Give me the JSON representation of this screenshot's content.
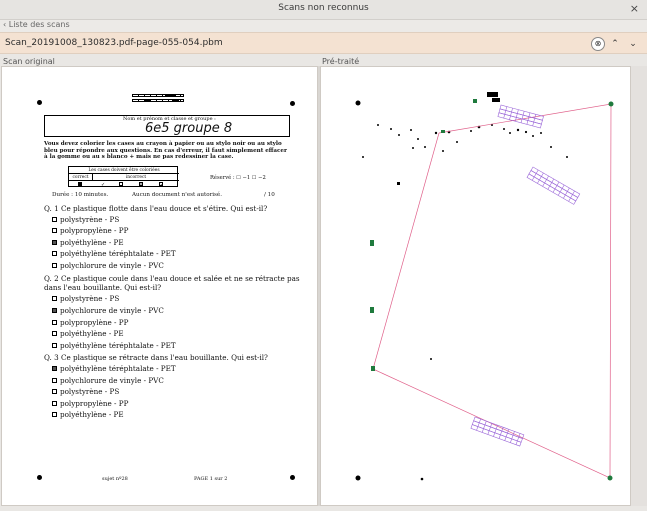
{
  "window": {
    "title": "Scans non reconnus",
    "close_label": "×"
  },
  "list_toggle": "‹ Liste des scans",
  "file": {
    "name": "Scan_20191008_130823.pdf-page-055-054.pbm",
    "clear_label": "⊗",
    "up_label": "⌃",
    "down_label": "⌄"
  },
  "panels": {
    "original": "Scan original",
    "processed": "Pré-traité"
  },
  "doc": {
    "name_prompt": "Nom et prénom et classe et groupe :",
    "handwriting": "6e5 groupe 8",
    "instructions": "Vous devez colorier les cases au crayon à papier ou au stylo noir ou au stylo bleu pour répondre aux questions. En cas d'erreur, il faut simplement effacer à la gomme ou au s blanco + mais ne pas redessiner la case.",
    "legend_title": "Les cases doivent être coloriées",
    "legend_correct": "correct",
    "legend_incorrect": "incorrect",
    "reserved": "Réservé : ☐ −1  ☐ −2",
    "duration": "Durée : 10 minutes.",
    "no_docs": "Aucun document n'est autorisé.",
    "score": "/ 10",
    "q1": {
      "title": "Q. 1  Ce plastique flotte dans l'eau douce et s'étire. Qui est-il?",
      "options": [
        "polystyrène - PS",
        "polypropylène - PP",
        "polyéthylène - PE",
        "polyéthylène téréphtalate - PET",
        "polychlorure de vinyle - PVC"
      ],
      "checked": [
        false,
        false,
        true,
        false,
        false
      ]
    },
    "q2": {
      "title_line1": "Q. 2  Ce plastique coule dans l'eau douce et salée et ne se rétracte pas",
      "title_line2": "dans l'eau bouillante. Qui est-il?",
      "options": [
        "polystyrène - PS",
        "polychlorure de vinyle - PVC",
        "polypropylène - PP",
        "polyéthylène - PE",
        "polyéthylène téréphtalate - PET"
      ],
      "checked": [
        false,
        true,
        false,
        false,
        false
      ]
    },
    "q3": {
      "title": "Q. 3  Ce plastique se rétracte dans l'eau bouillante. Qui est-il?",
      "options": [
        "polyéthylène téréphtalate - PET",
        "polychlorure de vinyle - PVC",
        "polystyrène - PS",
        "polypropylène - PP",
        "polyéthylène - PE"
      ],
      "checked": [
        true,
        false,
        false,
        false,
        false
      ]
    },
    "footer_subject": "sujet nº28",
    "footer_page": "PAGE 1 sur 2"
  },
  "colors": {
    "accent_bar": "#f4e2d2",
    "frame_line": "#e0608a",
    "marker_green": "#1f7a3d",
    "box_purple": "#9a66d8"
  }
}
